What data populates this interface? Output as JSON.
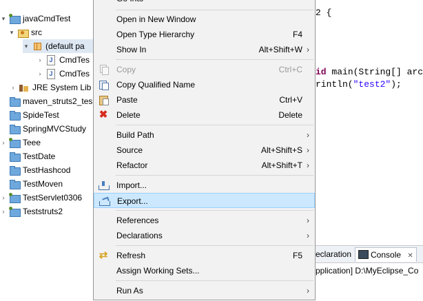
{
  "tree": {
    "items": [
      {
        "label": "javaCmdTest",
        "twisty": "▾",
        "icon": "project-icon"
      },
      {
        "label": "src",
        "twisty": "▾",
        "icon": "source-folder-icon"
      },
      {
        "label": "(default pa",
        "twisty": "▾",
        "icon": "package-icon"
      },
      {
        "label": "CmdTes",
        "twisty": "›",
        "icon": "java-file-icon"
      },
      {
        "label": "CmdTes",
        "twisty": "›",
        "icon": "java-file-icon"
      },
      {
        "label": "JRE System Lib",
        "twisty": "›",
        "icon": "library-icon"
      },
      {
        "label": "maven_struts2_tes",
        "twisty": "",
        "icon": "folder-icon"
      },
      {
        "label": "SpideTest",
        "twisty": "",
        "icon": "folder-icon"
      },
      {
        "label": "SpringMVCStudy",
        "twisty": "",
        "icon": "folder-icon"
      },
      {
        "label": "Teee",
        "twisty": "›",
        "icon": "project-icon"
      },
      {
        "label": "TestDate",
        "twisty": "",
        "icon": "folder-icon"
      },
      {
        "label": "TestHashcod",
        "twisty": "",
        "icon": "folder-icon"
      },
      {
        "label": "TestMoven",
        "twisty": "",
        "icon": "folder-icon"
      },
      {
        "label": "TestServlet0306",
        "twisty": "›",
        "icon": "project-icon"
      },
      {
        "label": "Teststruts2",
        "twisty": "›",
        "icon": "project-icon"
      }
    ]
  },
  "menu": {
    "top_partial": "Go Into",
    "items": [
      {
        "label": "Open in New Window",
        "accel": "",
        "submenu": false
      },
      {
        "label": "Open Type Hierarchy",
        "accel": "F4",
        "submenu": false
      },
      {
        "label": "Show In",
        "accel": "Alt+Shift+W",
        "submenu": true
      },
      {
        "label": "Copy",
        "accel": "Ctrl+C",
        "submenu": false,
        "disabled": true,
        "icon": "copy-icon"
      },
      {
        "label": "Copy Qualified Name",
        "accel": "",
        "submenu": false,
        "icon": "copy-qualified-name-icon"
      },
      {
        "label": "Paste",
        "accel": "Ctrl+V",
        "submenu": false,
        "icon": "paste-icon"
      },
      {
        "label": "Delete",
        "accel": "Delete",
        "submenu": false,
        "icon": "delete-icon"
      },
      {
        "label": "Build Path",
        "accel": "",
        "submenu": true
      },
      {
        "label": "Source",
        "accel": "Alt+Shift+S",
        "submenu": true
      },
      {
        "label": "Refactor",
        "accel": "Alt+Shift+T",
        "submenu": true
      },
      {
        "label": "Import...",
        "accel": "",
        "submenu": false,
        "icon": "import-icon"
      },
      {
        "label": "Export...",
        "accel": "",
        "submenu": false,
        "icon": "export-icon",
        "highlighted": true
      },
      {
        "label": "References",
        "accel": "",
        "submenu": true
      },
      {
        "label": "Declarations",
        "accel": "",
        "submenu": true
      },
      {
        "label": "Refresh",
        "accel": "F5",
        "submenu": false,
        "icon": "refresh-icon"
      },
      {
        "label": "Assign Working Sets...",
        "accel": "",
        "submenu": false
      },
      {
        "label": "Run As",
        "accel": "",
        "submenu": true
      }
    ],
    "arrow_glyph": "›",
    "delete_glyph": "✖",
    "refresh_glyph": "⇄"
  },
  "editor": {
    "line1": "2 {",
    "line2_kw": "id",
    "line2_rest": " main(String[] arc",
    "line3_pre": "rintln(",
    "line3_str": "\"test2\"",
    "line3_post": ");"
  },
  "bottom": {
    "tab_declaration": "eclaration",
    "tab_console": "Console",
    "tab_close": "✕",
    "console_line": "pplication] D:\\MyEclipse_Co"
  },
  "colors": {
    "menu_bg": "#f2f2f2",
    "highlight_bg": "#cce8ff",
    "keyword": "#7f0055",
    "string": "#2a00ff"
  }
}
